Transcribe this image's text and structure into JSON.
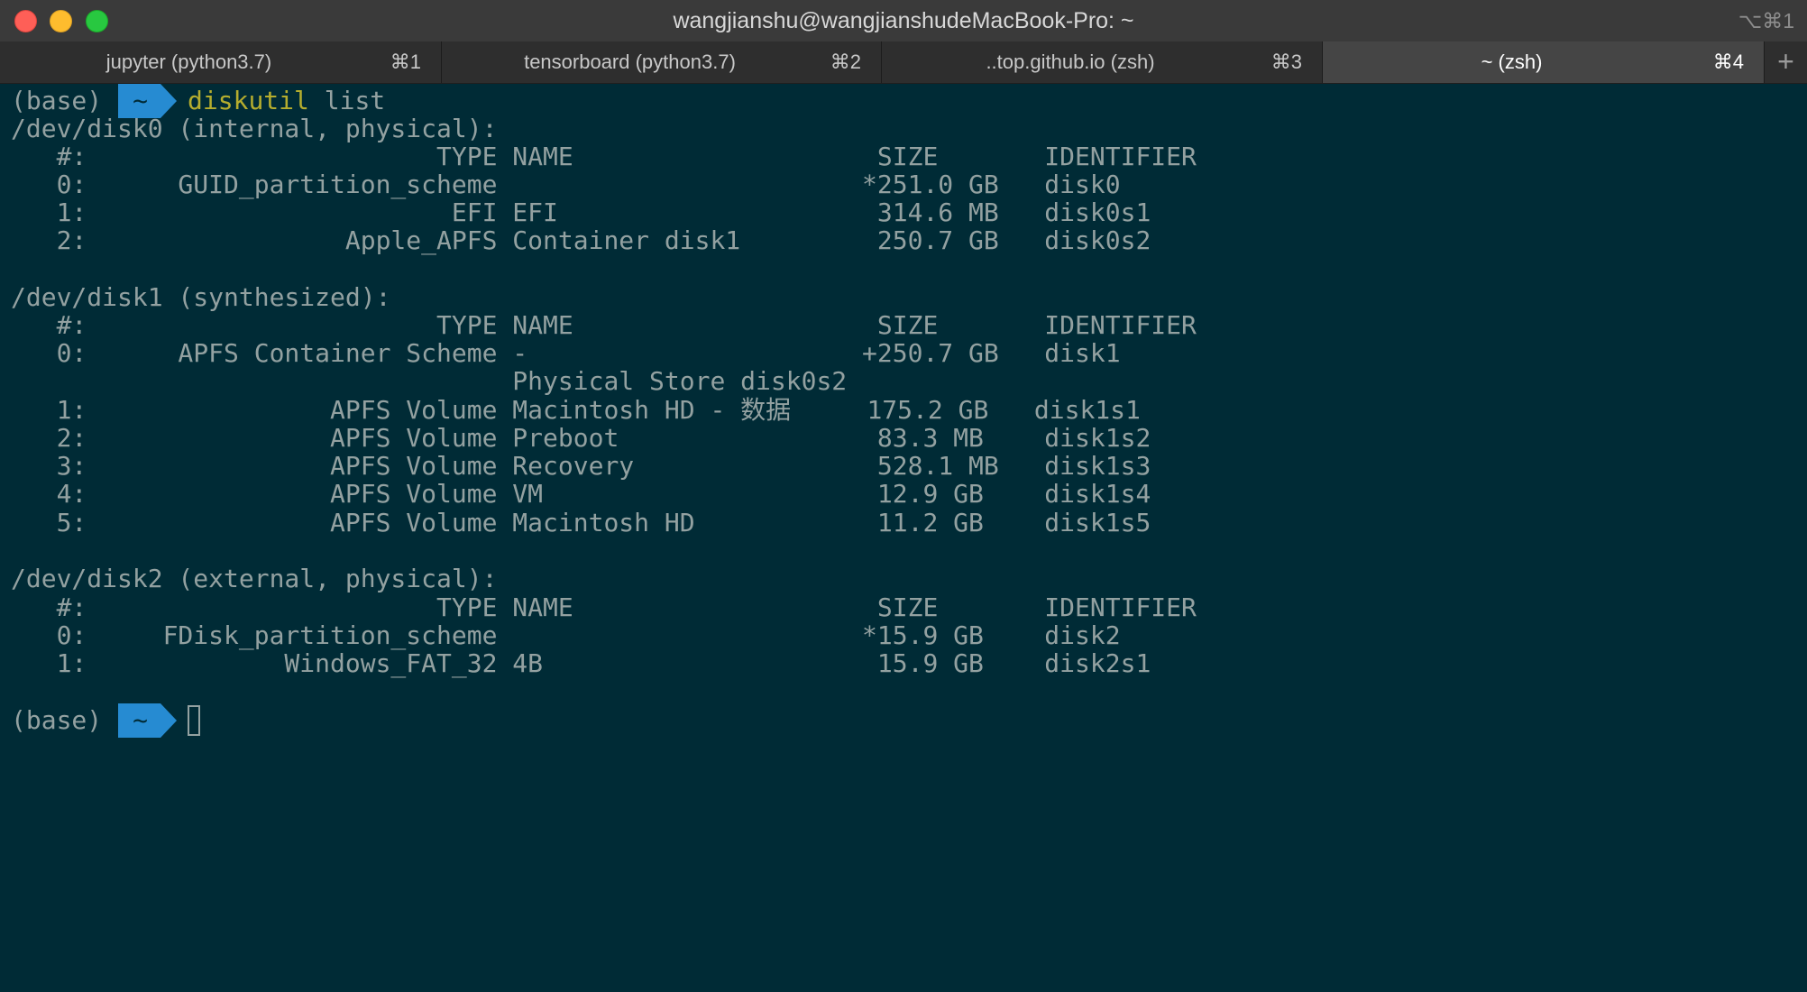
{
  "window": {
    "title": "wangjianshu@wangjianshudeMacBook-Pro: ~",
    "shortcut": "⌥⌘1"
  },
  "tabs": [
    {
      "label": "jupyter (python3.7)",
      "key": "⌘1",
      "active": false
    },
    {
      "label": "tensorboard (python3.7)",
      "key": "⌘2",
      "active": false
    },
    {
      "label": "..top.github.io (zsh)",
      "key": "⌘3",
      "active": false
    },
    {
      "label": "~ (zsh)",
      "key": "⌘4",
      "active": true
    }
  ],
  "new_tab_label": "+",
  "prompt": {
    "env": "(base)",
    "dir": "~",
    "command": "diskutil",
    "args": " list"
  },
  "output_lines": [
    "/dev/disk0 (internal, physical):",
    "   #:                       TYPE NAME                    SIZE       IDENTIFIER",
    "   0:      GUID_partition_scheme                        *251.0 GB   disk0",
    "   1:                        EFI EFI                     314.6 MB   disk0s1",
    "   2:                 Apple_APFS Container disk1         250.7 GB   disk0s2",
    "",
    "/dev/disk1 (synthesized):",
    "   #:                       TYPE NAME                    SIZE       IDENTIFIER",
    "   0:      APFS Container Scheme -                      +250.7 GB   disk1",
    "                                 Physical Store disk0s2",
    "   1:                APFS Volume Macintosh HD - 数据     175.2 GB   disk1s1",
    "   2:                APFS Volume Preboot                 83.3 MB    disk1s2",
    "   3:                APFS Volume Recovery                528.1 MB   disk1s3",
    "   4:                APFS Volume VM                      12.9 GB    disk1s4",
    "   5:                APFS Volume Macintosh HD            11.2 GB    disk1s5",
    "",
    "/dev/disk2 (external, physical):",
    "   #:                       TYPE NAME                    SIZE       IDENTIFIER",
    "   0:     FDisk_partition_scheme                        *15.9 GB    disk2",
    "   1:             Windows_FAT_32 4B                      15.9 GB    disk2s1",
    ""
  ]
}
